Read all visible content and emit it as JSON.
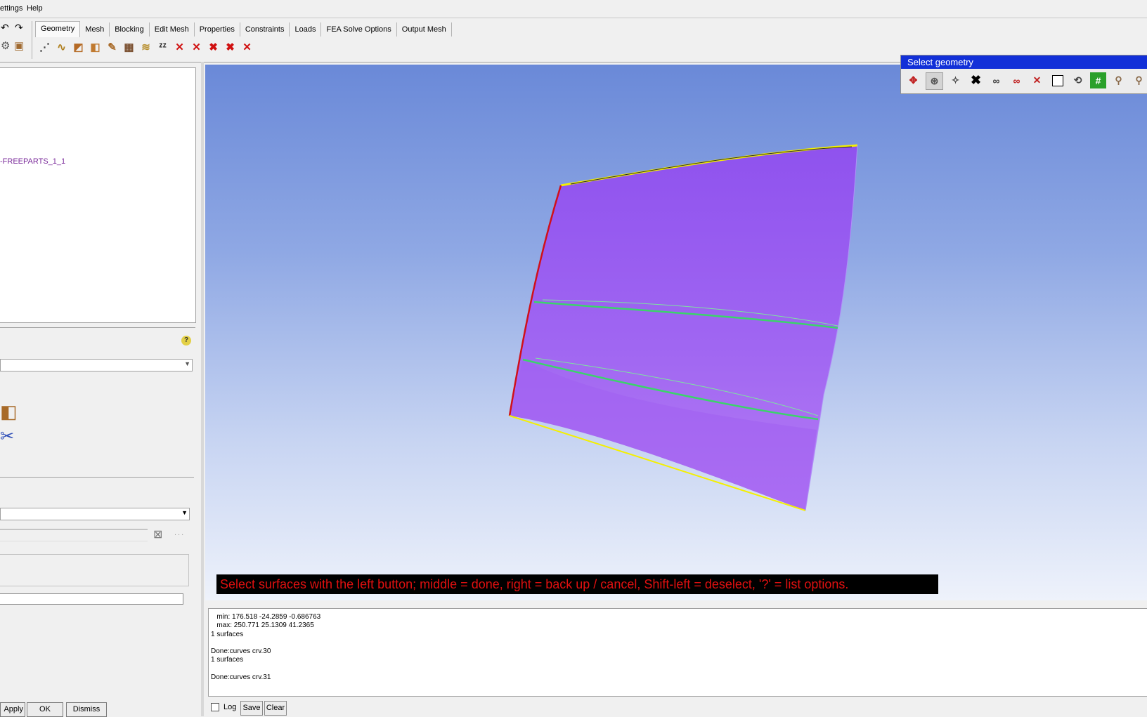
{
  "menubar": {
    "items": [
      "ettings",
      "Help"
    ]
  },
  "tabs": [
    "Geometry",
    "Mesh",
    "Blocking",
    "Edit Mesh",
    "Properties",
    "Constraints",
    "Loads",
    "FEA Solve Options",
    "Output Mesh"
  ],
  "active_tab": "Geometry",
  "toolbar_icons": [
    "create-point-icon",
    "create-curve-icon",
    "create-surface-icon",
    "create-body-icon",
    "repair-geometry-icon",
    "transform-icon",
    "geometry-layer-icon",
    "zz-icon",
    "delete-point-icon",
    "delete-curve-icon",
    "delete-surface-icon",
    "delete-body-icon",
    "delete-any-icon"
  ],
  "tree": {
    "item_label": "-FREEPARTS_1_1"
  },
  "form": {
    "buttons": {
      "apply": "Apply",
      "ok": "OK",
      "dismiss": "Dismiss"
    },
    "dots": "..."
  },
  "palette": {
    "title": "Select geometry",
    "icons": [
      "select-toggle-icon",
      "select-all-visible-icon",
      "select-star-icon",
      "select-x-icon",
      "select-glasses-icon",
      "select-glasses-red-icon",
      "cancel-x-icon",
      "box-select-icon",
      "polygon-select-icon",
      "select-part-icon",
      "select-by-name-icon",
      "select-by-family-icon"
    ]
  },
  "status_message": "Select surfaces with the left button; middle = done, right = back up / cancel, Shift-left = deselect, '?' = list options.",
  "log": {
    "lines": [
      "   min: 176.518 -24.2859 -0.686763",
      "   max: 250.771 25.1309 41.2365",
      "1 surfaces",
      "",
      "Done:curves crv.30",
      "1 surfaces",
      "",
      "Done:curves crv.31"
    ],
    "log_checkbox_label": "Log",
    "save_label": "Save",
    "clear_label": "Clear"
  },
  "colors": {
    "surface": "#9a5ef0",
    "edge_yellow": "#f4f000",
    "edge_red": "#d0101a",
    "curve_green": "#3bd46a",
    "palette_title_bg": "#1230d8",
    "message_text": "#e01010"
  }
}
